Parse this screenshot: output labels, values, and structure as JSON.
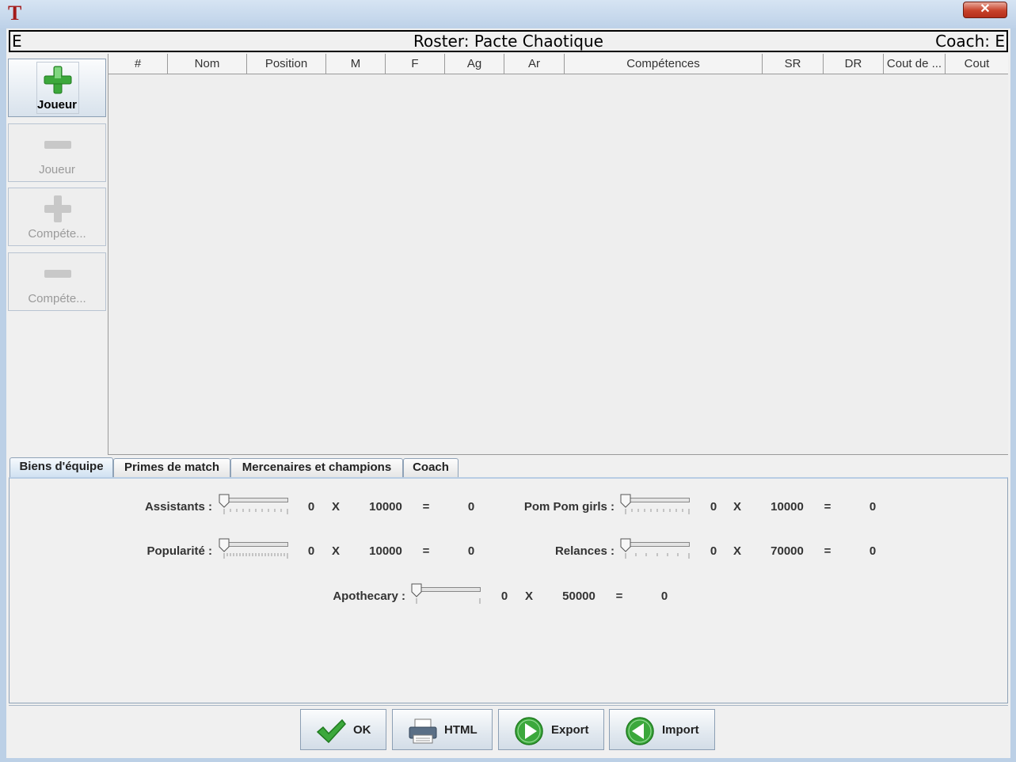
{
  "window": {
    "close_glyph": "✕"
  },
  "header": {
    "left": "E",
    "title": "Roster: Pacte Chaotique",
    "right": "Coach: E"
  },
  "side_buttons": [
    {
      "label": "Joueur",
      "icon": "plus-icon",
      "enabled": true
    },
    {
      "label": "Joueur",
      "icon": "minus-icon",
      "enabled": false
    },
    {
      "label": "Compéte...",
      "icon": "plus-icon",
      "enabled": false
    },
    {
      "label": "Compéte...",
      "icon": "minus-icon",
      "enabled": false
    }
  ],
  "table": {
    "columns": [
      "#",
      "Nom",
      "Position",
      "M",
      "F",
      "Ag",
      "Ar",
      "Compétences",
      "SR",
      "DR",
      "Cout de ...",
      "Cout"
    ],
    "rows": []
  },
  "tabs": [
    "Biens d'équipe",
    "Primes de match",
    "Mercenaires et champions",
    "Coach"
  ],
  "active_tab": "Biens d'équipe",
  "goods": {
    "assistants": {
      "label": "Assistants :",
      "count": "0",
      "times": "X",
      "price": "10000",
      "equals": "=",
      "total": "0"
    },
    "popularite": {
      "label": "Popularité :",
      "count": "0",
      "times": "X",
      "price": "10000",
      "equals": "=",
      "total": "0"
    },
    "pompom": {
      "label": "Pom Pom girls :",
      "count": "0",
      "times": "X",
      "price": "10000",
      "equals": "=",
      "total": "0"
    },
    "relances": {
      "label": "Relances :",
      "count": "0",
      "times": "X",
      "price": "70000",
      "equals": "=",
      "total": "0"
    },
    "apothecary": {
      "label": "Apothecary :",
      "count": "0",
      "times": "X",
      "price": "50000",
      "equals": "=",
      "total": "0"
    }
  },
  "footer": {
    "ok": "OK",
    "html": "HTML",
    "export": "Export",
    "import": "Import"
  },
  "colors": {
    "green": "#3ca83c",
    "disabled_gray": "#c8c8c8",
    "close_red": "#c7412a",
    "app_icon_red": "#a31a1a"
  }
}
